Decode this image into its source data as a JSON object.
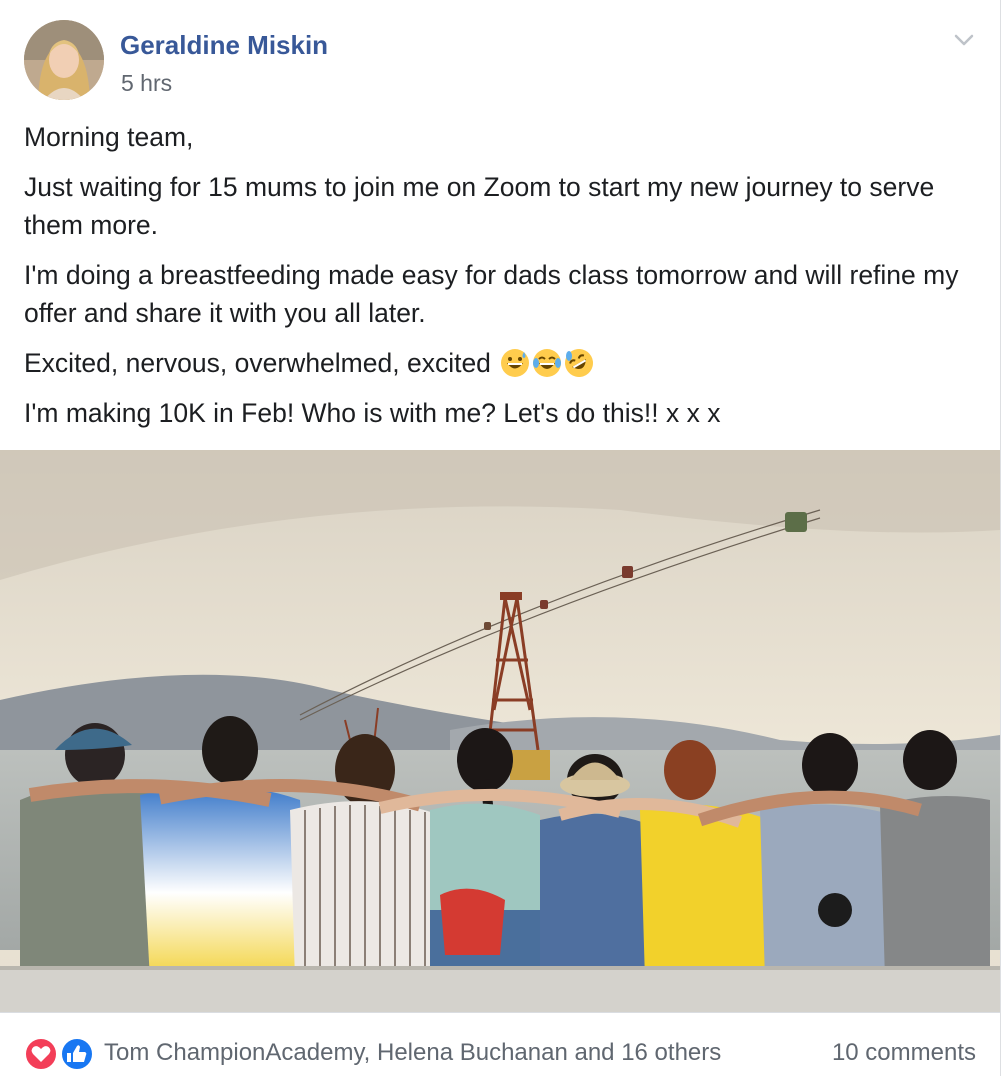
{
  "post": {
    "author": "Geraldine Miskin",
    "timestamp": "5 hrs",
    "paragraphs": [
      "Morning team,",
      "Just waiting for 15 mums to join me on Zoom to start my new journey to serve them more.",
      "I'm doing a breastfeeding made easy for dads class tomorrow and will refine my offer and share it with you all later.",
      "Excited, nervous, overwhelmed, excited",
      "I'm making 10K in Feb! Who is with me? Let's do this!! x x x"
    ],
    "emoji_icons": [
      "grinning-sweat-emoji-icon",
      "tears-of-joy-emoji-icon",
      "rofl-emoji-icon"
    ]
  },
  "reactions": {
    "icons": [
      "love-reaction-icon",
      "like-reaction-icon"
    ],
    "summary": "Tom ChampionAcademy, Helena Buchanan and 16 others",
    "comments": "10 comments"
  },
  "colors": {
    "author": "#385898",
    "love": "#f33e58",
    "like": "#1877f2"
  }
}
